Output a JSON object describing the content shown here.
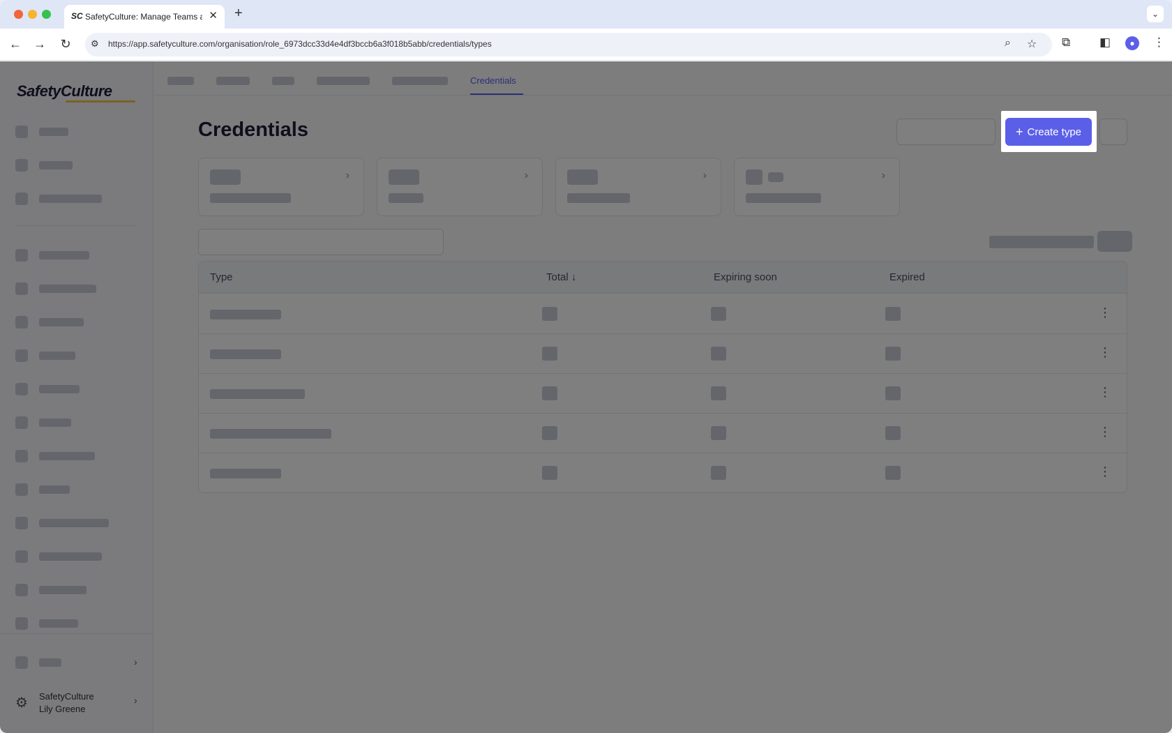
{
  "browser": {
    "tab_title": "SafetyCulture: Manage Teams and...",
    "tab_favicon": "SC",
    "tab_close": "✕",
    "new_tab": "+",
    "url": "https://app.safetyculture.com/organisation/role_6973dcc33d4e4df3bccb6a3f018b5abb/credentials/types"
  },
  "app": {
    "logo": "SafetyCulture",
    "nav_active": "Credentials",
    "page_title": "Credentials",
    "create_button": "Create type",
    "table": {
      "headers": [
        "Type",
        "Total",
        "Expiring soon",
        "Expired"
      ],
      "sort_indicator": "↓"
    },
    "sidebar_footer": {
      "org": "SafetyCulture",
      "user": "Lily Greene"
    }
  },
  "colors": {
    "accent": "#5b5fe8"
  }
}
